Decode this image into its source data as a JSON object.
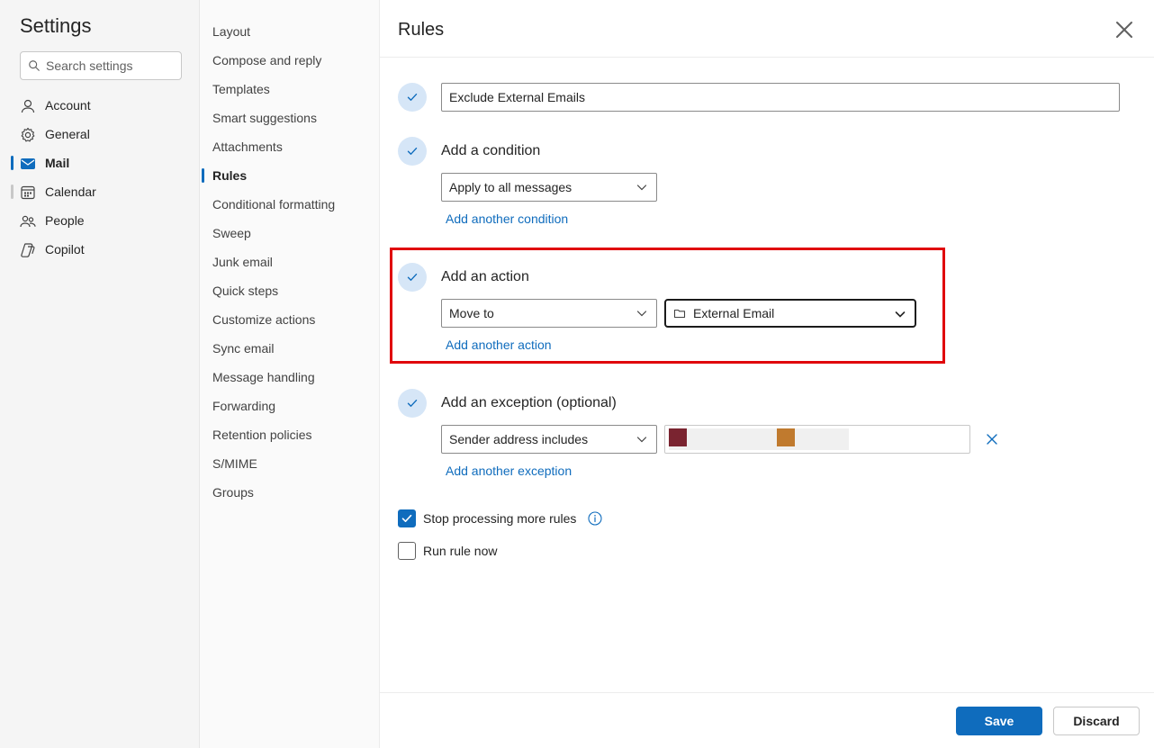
{
  "sidebar": {
    "title": "Settings",
    "search_placeholder": "Search settings",
    "items": [
      {
        "label": "Account",
        "icon": "person-icon"
      },
      {
        "label": "General",
        "icon": "gear-icon"
      },
      {
        "label": "Mail",
        "icon": "mail-icon",
        "active": true
      },
      {
        "label": "Calendar",
        "icon": "calendar-icon"
      },
      {
        "label": "People",
        "icon": "people-icon"
      },
      {
        "label": "Copilot",
        "icon": "copilot-icon"
      }
    ]
  },
  "subnav": {
    "items": [
      "Layout",
      "Compose and reply",
      "Templates",
      "Smart suggestions",
      "Attachments",
      "Rules",
      "Conditional formatting",
      "Sweep",
      "Junk email",
      "Quick steps",
      "Customize actions",
      "Sync email",
      "Message handling",
      "Forwarding",
      "Retention policies",
      "S/MIME",
      "Groups"
    ],
    "active": "Rules"
  },
  "panel": {
    "title": "Rules",
    "rule_name": "Exclude External Emails",
    "condition": {
      "heading": "Add a condition",
      "selected": "Apply to all messages",
      "link": "Add another condition"
    },
    "action": {
      "heading": "Add an action",
      "selected": "Move to",
      "folder": "External Email",
      "link": "Add another action"
    },
    "exception": {
      "heading": "Add an exception (optional)",
      "selected": "Sender address includes",
      "link": "Add another exception"
    },
    "stop_processing": {
      "label": "Stop processing more rules",
      "checked": true
    },
    "run_now": {
      "label": "Run rule now",
      "checked": false
    },
    "save_label": "Save",
    "discard_label": "Discard"
  },
  "colors": {
    "accent": "#0f6cbd",
    "highlight": "#e0060c",
    "check_bg": "#d6e6f7"
  }
}
